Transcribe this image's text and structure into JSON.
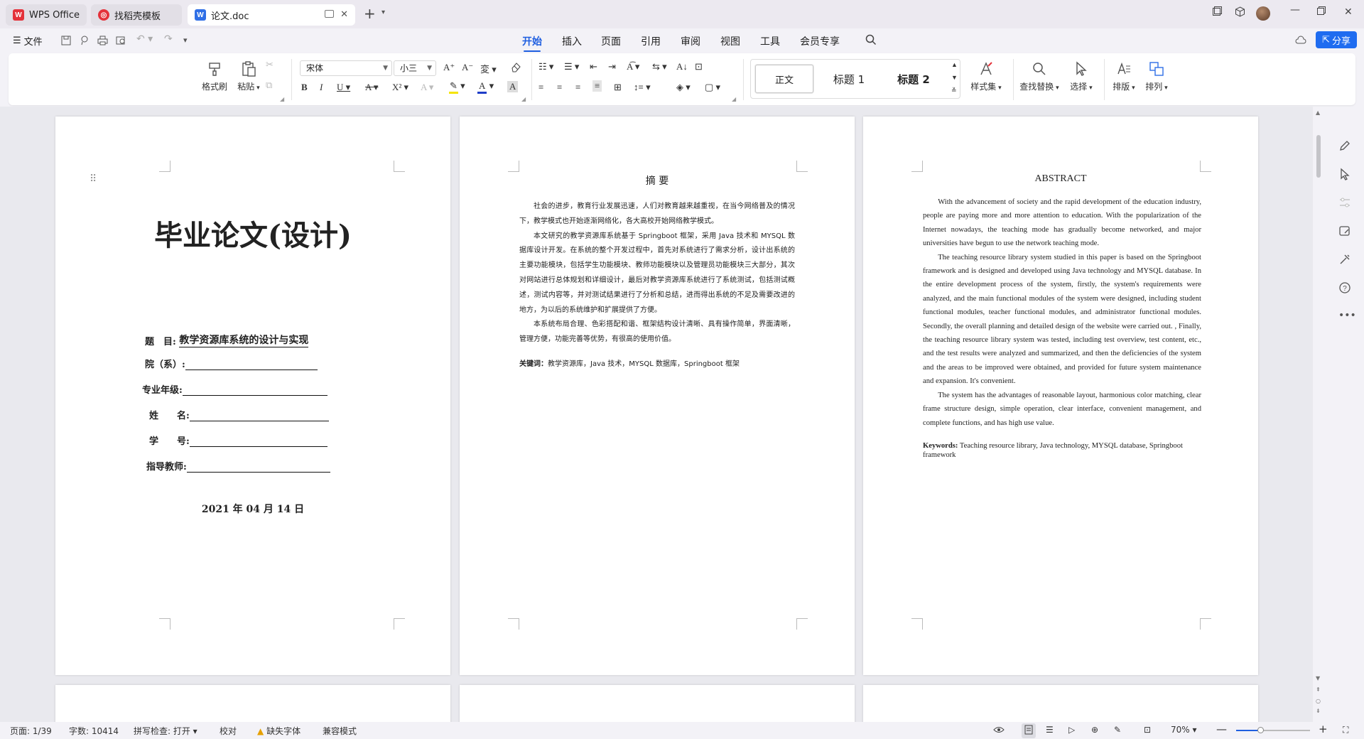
{
  "tabs": {
    "wps": "WPS Office",
    "templates": "找稻壳模板",
    "doc": "论文.doc",
    "doc_icon_letter": "W"
  },
  "menu": {
    "file": "文件",
    "items": [
      "开始",
      "插入",
      "页面",
      "引用",
      "审阅",
      "视图",
      "工具",
      "会员专享"
    ],
    "active": "开始",
    "share": "分享"
  },
  "ribbon": {
    "format_painter": "格式刷",
    "paste": "粘贴",
    "font_name": "宋体",
    "font_size": "小三",
    "styles": [
      "正文",
      "标题 1",
      "标题 2"
    ],
    "style_set": "样式集",
    "find_replace": "查找替换",
    "select": "选择",
    "layout": "排版",
    "arrange": "排列"
  },
  "page1": {
    "title": "毕业论文(设计)",
    "topic_label": "题　目:",
    "topic": "教学资源库系统的设计与实现",
    "dept_label": "院（系）:",
    "major_label": "专业年级:",
    "name_label": "姓　　名:",
    "id_label": "学　　号:",
    "advisor_label": "指导教师:",
    "date": "2021 年 04 月 14 日"
  },
  "page2": {
    "heading": "摘 要",
    "para1": "社会的进步，教育行业发展迅速，人们对教育越来越重视，在当今网络普及的情况下，教学模式也开始逐渐网络化，各大高校开始网络教学模式。",
    "para2": "本文研究的教学资源库系统基于 Springboot 框架，采用 Java 技术和 MYSQL 数据库设计开发。在系统的整个开发过程中，首先对系统进行了需求分析，设计出系统的主要功能模块，包括学生功能模块、教师功能模块以及管理员功能模块三大部分，其次对网站进行总体规划和详细设计，最后对教学资源库系统进行了系统测试，包括测试概述，测试内容等，并对测试结果进行了分析和总结，进而得出系统的不足及需要改进的地方，为以后的系统维护和扩展提供了方便。",
    "para3": "本系统布局合理、色彩搭配和谐、框架结构设计清晰、具有操作简单，界面清晰，管理方便，功能完善等优势，有很高的使用价值。",
    "keywords_label": "关键词：",
    "keywords": "教学资源库，Java 技术，MYSQL 数据库，Springboot 框架"
  },
  "page3": {
    "heading": "ABSTRACT",
    "para1": "With the advancement of society and the rapid development of the education industry, people are paying more and more attention to education. With the popularization of the Internet nowadays, the teaching mode has gradually become networked, and major universities have begun to use the network teaching mode.",
    "para2": "The teaching resource library system studied in this paper is based on the Springboot framework and is designed and developed using Java technology and MYSQL database. In the entire development process of the system, firstly, the system's requirements were analyzed, and the main functional modules of the system were designed, including student functional modules, teacher functional modules, and administrator functional modules. Secondly, the overall planning and detailed design of the website were carried out. , Finally, the teaching resource library system was tested, including test overview, test content, etc., and the test results were analyzed and summarized, and then the deficiencies of the system and the areas to be improved were obtained, and provided for future system maintenance and expansion. It's convenient.",
    "para3": "The system has the advantages of reasonable layout, harmonious color matching, clear frame structure design, simple operation, clear interface, convenient management, and complete functions, and has high use value.",
    "keywords_label": "Keywords:",
    "keywords": "Teaching resource library, Java technology, MYSQL database, Springboot framework"
  },
  "status": {
    "page": "页面: 1/39",
    "words": "字数: 10414",
    "spell": "拼写检查: 打开",
    "proof": "校对",
    "missing_font": "缺失字体",
    "compat": "兼容模式",
    "zoom": "70%"
  },
  "colors": {
    "accent": "#1f5fe0",
    "share_bg": "#1f6cf0",
    "wps_red": "#e4323b",
    "word_blue": "#2f6fe6"
  }
}
